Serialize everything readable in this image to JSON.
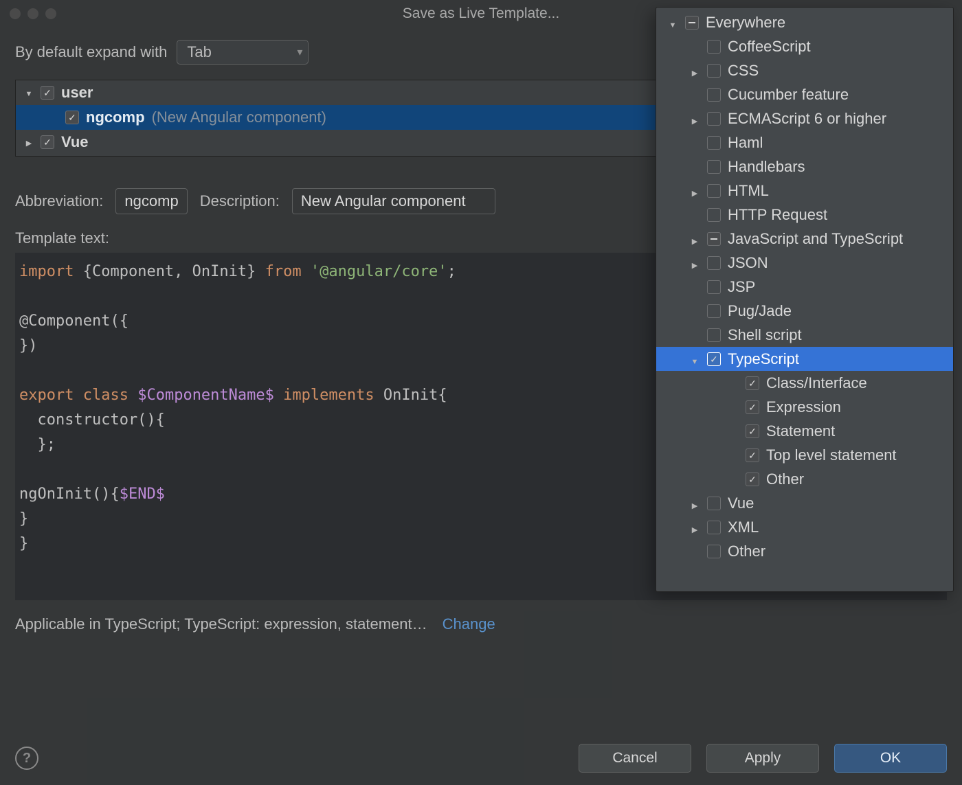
{
  "title": "Save as Live Template...",
  "expand": {
    "label": "By default expand with",
    "value": "Tab"
  },
  "template_tree": [
    {
      "name": "user",
      "checked": true,
      "expanded": true,
      "level": 0
    },
    {
      "name": "ngcomp",
      "desc": "(New Angular component)",
      "checked": true,
      "level": 1,
      "selected": true
    },
    {
      "name": "Vue",
      "checked": true,
      "expanded": false,
      "level": 0
    }
  ],
  "abbrev": {
    "label": "Abbreviation:",
    "value": "ngcomp"
  },
  "desc": {
    "label": "Description:",
    "value": "New Angular component"
  },
  "template_text_label": "Template text:",
  "code": {
    "line1_kw": "import",
    "line1_mid": " {Component, OnInit} ",
    "line1_from": "from",
    "line1_sp": " ",
    "line1_str": "'@angular/core'",
    "line1_end": ";",
    "line3": "@Component({",
    "line4": "})",
    "line6_export": "export",
    "line6_class": "class",
    "line6_var": "$ComponentName$",
    "line6_impl": "implements",
    "line6_on": "OnInit{",
    "line7": "  constructor(){",
    "line8": "  };",
    "line10_a": "ngOnInit(){",
    "line10_var": "$END$",
    "line11": "}",
    "line12": "}"
  },
  "applicable": {
    "text": "Applicable in TypeScript; TypeScript: expression, statement…",
    "change": "Change"
  },
  "buttons": {
    "cancel": "Cancel",
    "apply": "Apply",
    "ok": "OK"
  },
  "context_popup": [
    {
      "label": "Everywhere",
      "state": "indet",
      "level": 0,
      "expand": "down"
    },
    {
      "label": "CoffeeScript",
      "state": "empty",
      "level": 1
    },
    {
      "label": "CSS",
      "state": "empty",
      "level": 1,
      "expand": "right"
    },
    {
      "label": "Cucumber feature",
      "state": "empty",
      "level": 1
    },
    {
      "label": "ECMAScript 6 or higher",
      "state": "empty",
      "level": 1,
      "expand": "right"
    },
    {
      "label": "Haml",
      "state": "empty",
      "level": 1
    },
    {
      "label": "Handlebars",
      "state": "empty",
      "level": 1
    },
    {
      "label": "HTML",
      "state": "empty",
      "level": 1,
      "expand": "right"
    },
    {
      "label": "HTTP Request",
      "state": "empty",
      "level": 1
    },
    {
      "label": "JavaScript and TypeScript",
      "state": "indet",
      "level": 1,
      "expand": "right"
    },
    {
      "label": "JSON",
      "state": "empty",
      "level": 1,
      "expand": "right"
    },
    {
      "label": "JSP",
      "state": "empty",
      "level": 1
    },
    {
      "label": "Pug/Jade",
      "state": "empty",
      "level": 1
    },
    {
      "label": "Shell script",
      "state": "empty",
      "level": 1
    },
    {
      "label": "TypeScript",
      "state": "mark",
      "level": 1,
      "expand": "down",
      "selected": true
    },
    {
      "label": "Class/Interface",
      "state": "mark",
      "level": 2
    },
    {
      "label": "Expression",
      "state": "mark",
      "level": 2
    },
    {
      "label": "Statement",
      "state": "mark",
      "level": 2
    },
    {
      "label": "Top level statement",
      "state": "mark",
      "level": 2
    },
    {
      "label": "Other",
      "state": "mark",
      "level": 2
    },
    {
      "label": "Vue",
      "state": "empty",
      "level": 1,
      "expand": "right"
    },
    {
      "label": "XML",
      "state": "empty",
      "level": 1,
      "expand": "right"
    },
    {
      "label": "Other",
      "state": "empty",
      "level": 1
    }
  ]
}
